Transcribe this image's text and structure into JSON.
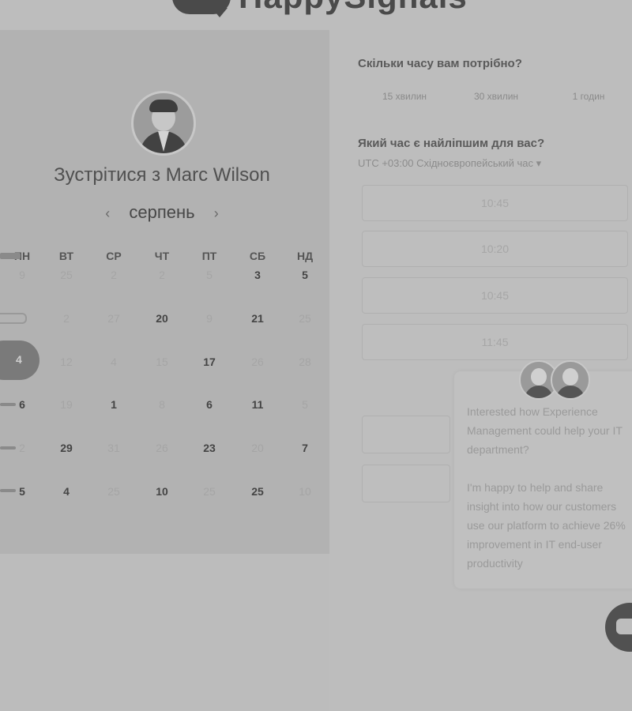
{
  "brand": {
    "logo_text": "HappySignals"
  },
  "calendar": {
    "host_title": "Зустрітися з Marc Wilson",
    "month": "серпень",
    "prev_icon": "chevron-left-icon",
    "next_icon": "chevron-right-icon",
    "weekdays": [
      "ПН",
      "ВТ",
      "СР",
      "ЧТ",
      "ПТ",
      "СБ",
      "НД"
    ],
    "weeks": [
      [
        "9",
        "25",
        "2",
        "2",
        "5",
        "3",
        "5"
      ],
      [
        "",
        "2",
        "27",
        "20",
        "9",
        "21",
        "25"
      ],
      [
        "4",
        "12",
        "4",
        "15",
        "17",
        "26",
        "28"
      ],
      [
        "6",
        "19",
        "1",
        "8",
        "6",
        "11",
        "5"
      ],
      [
        "2",
        "29",
        "31",
        "26",
        "23",
        "20",
        "7"
      ],
      [
        "5",
        "4",
        "25",
        "10",
        "25",
        "25",
        "10"
      ]
    ],
    "selected_day": "4"
  },
  "duration": {
    "question": "Скільки часу вам потрібно?",
    "options": [
      "15 хвилин",
      "30 хвилин",
      "1 годин"
    ]
  },
  "time": {
    "question": "Який час є найліпшим для вас?",
    "timezone": "UTC +03:00 Східноєвропейський час ▾",
    "slots": [
      "10:45",
      "10:20",
      "10:45",
      "11:45"
    ]
  },
  "chat": {
    "message_p1": "Interested how Experience Management could help your IT department?",
    "message_p2": "I'm happy to help and share insight into how our customers use our platform to achieve 26% improvement in IT end-user productivity",
    "button_icon": "chat-bubble-icon"
  }
}
